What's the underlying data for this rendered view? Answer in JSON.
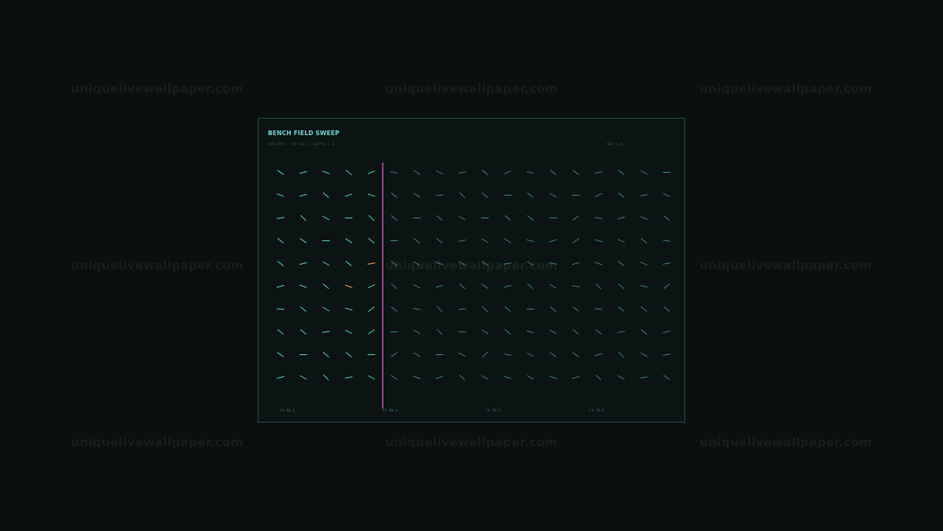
{
  "watermark": {
    "text": "uniquelivewallpaper.com"
  },
  "panel": {
    "title": "BENCH FIELD SWEEP",
    "subtitle": "SYN-DRV / ARC-RSL / DEPTH 2.3",
    "readout": "SWP 0.31",
    "x_ticks": [
      "F1 44.3",
      "F2 88.4",
      "F3 79.2",
      "F4 79.6"
    ]
  },
  "chart_data": {
    "type": "vector-field",
    "rows": 10,
    "cols": 18,
    "sweep_column_index": 5,
    "colors": {
      "left_region": "#5bd3c9",
      "right_region": "#3e8d87",
      "highlight": "#e0a060",
      "sweep_line": "#e070c0",
      "panel_border": "#2b4e48",
      "background": "#0a0f0f"
    },
    "highlights": [
      {
        "row": 4,
        "col": 4
      },
      {
        "row": 5,
        "col": 3
      }
    ],
    "angles_deg": [
      [
        35,
        -15,
        20,
        40,
        -20,
        10,
        35,
        25,
        -10,
        40,
        -25,
        15,
        40,
        35,
        -10,
        40,
        30,
        0
      ],
      [
        20,
        -15,
        40,
        -20,
        20,
        40,
        30,
        -5,
        45,
        40,
        0,
        40,
        30,
        0,
        -30,
        40,
        -10,
        25
      ],
      [
        -10,
        45,
        30,
        0,
        45,
        40,
        0,
        40,
        30,
        0,
        40,
        40,
        0,
        -35,
        10,
        -20,
        25,
        40
      ],
      [
        40,
        35,
        0,
        35,
        40,
        0,
        40,
        40,
        -10,
        30,
        35,
        15,
        -20,
        -35,
        15,
        25,
        40,
        10
      ],
      [
        40,
        -15,
        30,
        40,
        -10,
        40,
        30,
        20,
        30,
        30,
        -10,
        30,
        10,
        -15,
        20,
        40,
        25,
        -10
      ],
      [
        -15,
        20,
        40,
        20,
        -25,
        40,
        25,
        -15,
        40,
        35,
        -15,
        40,
        30,
        10,
        45,
        40,
        10,
        -40
      ],
      [
        5,
        40,
        30,
        15,
        -40,
        40,
        10,
        45,
        -5,
        45,
        40,
        0,
        40,
        35,
        5,
        40,
        40,
        40
      ],
      [
        40,
        40,
        -10,
        25,
        -35,
        0,
        30,
        45,
        5,
        30,
        40,
        15,
        30,
        40,
        35,
        -10,
        40,
        -15
      ],
      [
        35,
        0,
        40,
        40,
        0,
        -35,
        30,
        0,
        30,
        -45,
        10,
        25,
        35,
        35,
        -20,
        45,
        30,
        -10
      ],
      [
        -15,
        30,
        45,
        -10,
        30,
        35,
        20,
        -20,
        45,
        30,
        15,
        30,
        20,
        -15,
        45,
        30,
        -10,
        35
      ]
    ]
  }
}
